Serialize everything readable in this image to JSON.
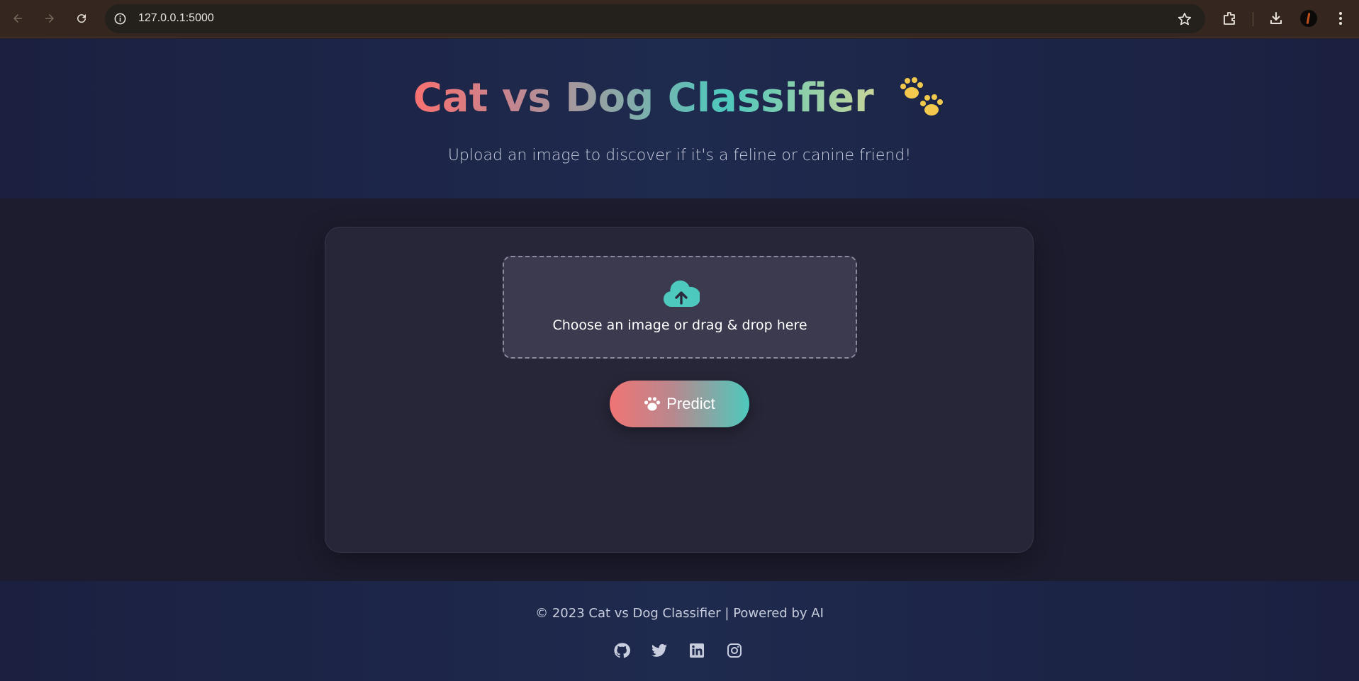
{
  "browser": {
    "url": "127.0.0.1:5000",
    "icons": [
      "back-arrow-icon",
      "forward-arrow-icon",
      "reload-icon",
      "site-info-icon",
      "bookmark-star-icon",
      "extensions-icon",
      "download-icon",
      "profile-avatar",
      "kebab-menu-icon"
    ]
  },
  "header": {
    "title": "Cat vs Dog Classifier",
    "title_icon": "paw-icon",
    "subtitle": "Upload an image to discover if it's a feline or canine friend!"
  },
  "upload": {
    "icon": "cloud-upload-icon",
    "label": "Choose an image or drag & drop here"
  },
  "predict": {
    "icon": "paw-icon",
    "label": "Predict"
  },
  "footer": {
    "copyright": "© 2023 Cat vs Dog Classifier | Powered by AI",
    "social_icons": [
      "github-icon",
      "twitter-icon",
      "linkedin-icon",
      "instagram-icon"
    ]
  },
  "colors": {
    "accent_coral": "#f87171",
    "accent_teal": "#4ec9bd",
    "paw_yellow": "#f2c94c",
    "background": "#1c1c2e",
    "card": "#262638"
  }
}
